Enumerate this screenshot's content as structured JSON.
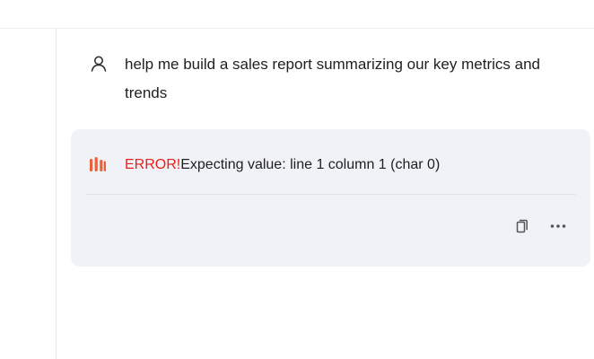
{
  "conversation": {
    "user_message": "help me build a sales report summarizing our key metrics and trends",
    "reply": {
      "error_label": "ERROR!",
      "error_message": "Expecting value: line 1 column 1 (char 0)"
    }
  },
  "icons": {
    "user": "user-icon",
    "bot": "bot-logo-icon",
    "copy": "copy-icon",
    "more": "more-dots-icon"
  },
  "colors": {
    "error": "#e8201a",
    "logo": "#e8623a",
    "card_background": "#f0f2f7"
  }
}
